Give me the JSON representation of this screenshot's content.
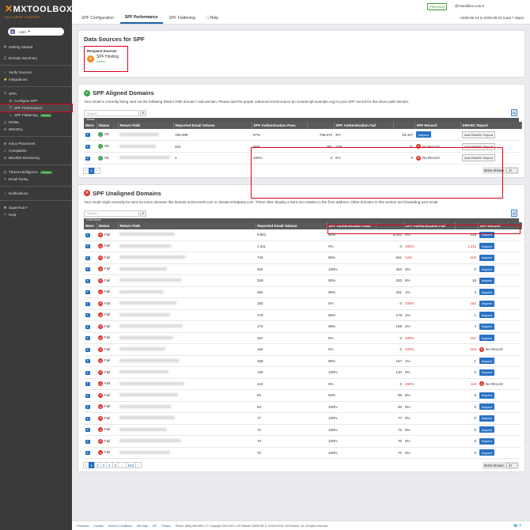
{
  "brand": {
    "title": "MXTOOLBOX",
    "subtitle": "DELIVERY CENTER",
    "accent": "#f08c1e"
  },
  "account": {
    "initial": "E",
    "name": ".com"
  },
  "sidebar": [
    {
      "label": "Getting Started",
      "icon": "flag-icon"
    },
    {
      "label": "Domain Summary",
      "icon": "list-icon"
    },
    {
      "label": "Verify Sources",
      "icon": "check-icon"
    },
    {
      "label": "Integrations",
      "icon": "plug-icon"
    },
    {
      "label": "SPF",
      "icon": "shield-icon"
    },
    {
      "label": "Configure SPF",
      "icon": "gear-icon"
    },
    {
      "label": "SPF Performance",
      "icon": "shield-icon"
    },
    {
      "label": "SPF Flattening",
      "icon": "layers-icon",
      "tag": "Preview"
    },
    {
      "label": "DKIM",
      "icon": "key-icon"
    },
    {
      "label": "DMARC",
      "icon": "envelope-icon"
    },
    {
      "label": "Inbox Placement",
      "icon": "inbox-icon"
    },
    {
      "label": "Complaints",
      "icon": "alert-icon"
    },
    {
      "label": "Blocklist Monitoring",
      "icon": "ban-icon"
    },
    {
      "label": "Threat Intelligence",
      "icon": "target-icon",
      "tag": "Preview"
    },
    {
      "label": "Email Tools",
      "icon": "wrench-icon"
    },
    {
      "label": "Notifications",
      "icon": "bell-icon"
    },
    {
      "label": "SuperTool",
      "icon": "tool-icon"
    },
    {
      "label": "Help",
      "icon": "help-icon"
    }
  ],
  "tabs": [
    "SPF Configuration",
    "SPF Performance",
    "SPF Flattening",
    "Help"
  ],
  "premium": "PREMIUM",
  "user": "@mxtoolbox.com ▾",
  "daterange": "‹ 2025-05-14 to 2025-05-21 (Last 7 days)",
  "data_sources": {
    "title": "Data Sources for SPF",
    "label": "Recipient Sources",
    "item": "SPF Hosting",
    "status": "Active"
  },
  "aligned": {
    "title": "SPF Aligned Domains",
    "desc": "Your email is currently being sent via the following Return Path domain / sub-domain. Please add the proper outbound email source (ie include:spf.example.org) to your SPF record for the return path domain.",
    "search": "Search",
    "count": "3 items",
    "headers": [
      "More",
      "Status",
      "Return Path",
      "Reported Email Volume",
      "SPF Authentication Pass",
      "",
      "SPF Authentication Fail",
      "",
      "SPF Record",
      "DMARC Report"
    ],
    "rows": [
      {
        "status": "Ok",
        "vol": "780,099",
        "pp": "97%",
        "pn": "769,672",
        "fp": "3%",
        "fn": "20,427",
        "rec": "Inspect",
        "dmarc": "Add DMARC Report"
      },
      {
        "status": "Ok",
        "vol": "322",
        "pp": "90%",
        "pn": "291",
        "fp": "10%",
        "fn": "31",
        "rec": "No Record",
        "dmarc": "Add DMARC Report"
      },
      {
        "status": "Ok",
        "vol": "3",
        "pp": "100%",
        "pn": "3",
        "fp": "0%",
        "fn": "0",
        "rec": "No Record",
        "dmarc": "Add DMARC Report"
      }
    ],
    "pager": [
      "‹",
      "1",
      "›"
    ],
    "items_shown": "Items Shown",
    "items_val": "20 ÷"
  },
  "unaligned": {
    "title": "SPF Unaligned Domains",
    "desc": "Your email might currently be sent via some domains like domain.onmicrosoft.com or domain.thirdparty.com. These often display a Sent Via notation in the from address. Other domains in this section are forwarding your email.",
    "search": "Search",
    "count": "10,844 items",
    "headers": [
      "More",
      "Status",
      "Return Path",
      "Reported Email Volume",
      "SPF Authentication Pass",
      "",
      "SPF Authentication Fail",
      "",
      "SPF Record"
    ],
    "rows": [
      {
        "vol": "8,661",
        "pp": "95%",
        "pn": "8,243",
        "fp": "5%",
        "fn": "418",
        "rec": "Inspect"
      },
      {
        "vol": "1,311",
        "pp": "0%",
        "pn": "0",
        "fp": "100%",
        "fn": "1,311",
        "rec": "Inspect",
        "red": true
      },
      {
        "vol": "743",
        "pp": "86%",
        "pn": "641",
        "fp": "14%",
        "fn": "102",
        "rec": "Inspect",
        "red": true
      },
      {
        "vol": "404",
        "pp": "100%",
        "pn": "404",
        "fp": "0%",
        "fn": "0",
        "rec": "Inspect"
      },
      {
        "vol": "349",
        "pp": "95%",
        "pn": "333",
        "fp": "5%",
        "fn": "16",
        "rec": "Inspect"
      },
      {
        "vol": "264",
        "pp": "99%",
        "pn": "261",
        "fp": "1%",
        "fn": "3",
        "rec": "Inspect"
      },
      {
        "vol": "182",
        "pp": "0%",
        "pn": "0",
        "fp": "100%",
        "fn": "182",
        "rec": "Inspect",
        "red": true
      },
      {
        "vol": "179",
        "pp": "99%",
        "pn": "178",
        "fp": "1%",
        "fn": "1",
        "rec": "Inspect"
      },
      {
        "vol": "173",
        "pp": "98%",
        "pn": "169",
        "fp": "2%",
        "fn": "4",
        "rec": "Inspect"
      },
      {
        "vol": "167",
        "pp": "0%",
        "pn": "0",
        "fp": "100%",
        "fn": "167",
        "rec": "Inspect",
        "red": true
      },
      {
        "vol": "164",
        "pp": "0%",
        "pn": "0",
        "fp": "100%",
        "fn": "164",
        "rec": "No Record",
        "red": true
      },
      {
        "vol": "158",
        "pp": "99%",
        "pn": "157",
        "fp": "1%",
        "fn": "1",
        "rec": "Inspect"
      },
      {
        "vol": "130",
        "pp": "100%",
        "pn": "130",
        "fp": "0%",
        "fn": "0",
        "rec": "Inspect"
      },
      {
        "vol": "119",
        "pp": "0%",
        "pn": "0",
        "fp": "100%",
        "fn": "119",
        "rec": "No Record",
        "red": true
      },
      {
        "vol": "94",
        "pp": "94%",
        "pn": "88",
        "fp": "6%",
        "fn": "6",
        "rec": "Inspect"
      },
      {
        "vol": "83",
        "pp": "100%",
        "pn": "83",
        "fp": "0%",
        "fn": "0",
        "rec": "Inspect"
      },
      {
        "vol": "77",
        "pp": "100%",
        "pn": "77",
        "fp": "0%",
        "fn": "0",
        "rec": "Inspect"
      },
      {
        "vol": "72",
        "pp": "100%",
        "pn": "72",
        "fp": "0%",
        "fn": "0",
        "rec": "Inspect"
      },
      {
        "vol": "70",
        "pp": "100%",
        "pn": "70",
        "fp": "0%",
        "fn": "0",
        "rec": "Inspect"
      },
      {
        "vol": "70",
        "pp": "100%",
        "pn": "70",
        "fp": "0%",
        "fn": "0",
        "rec": "Inspect"
      }
    ],
    "status": "Fail",
    "pager": [
      "‹",
      "1",
      "2",
      "3",
      "4",
      "5",
      "…",
      "543",
      "›"
    ],
    "items_shown": "Items Shown",
    "items_val": "20 ÷"
  },
  "footer": [
    "Feedback",
    "Contact",
    "Terms & Conditions",
    "Site Map",
    "API",
    "Privacy",
    "Phone: (866)-698-6652 | © Copyright 2004-2021, US Patents 10838 350 & 11461139 B2, MXToolbox, Inc. All rights reserved"
  ]
}
